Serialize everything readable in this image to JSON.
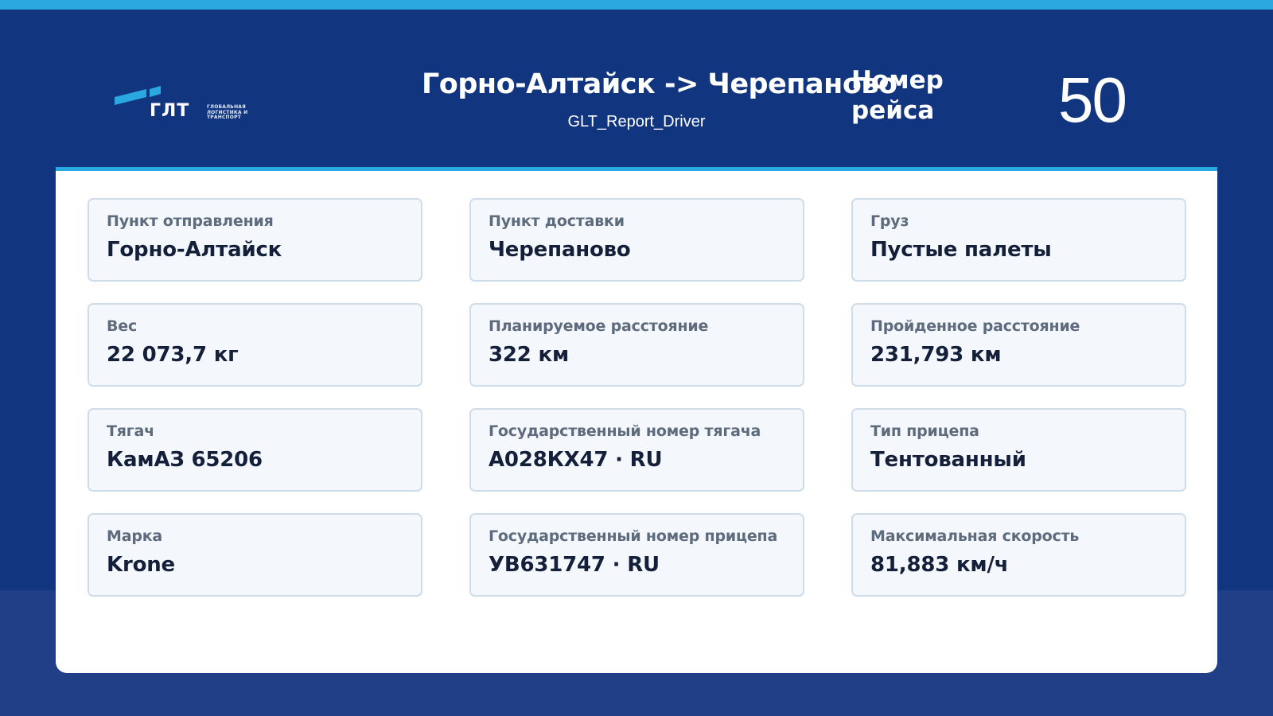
{
  "colors": {
    "background": "#12357f",
    "accent": "#2aa9e0",
    "card": "#ffffff",
    "field_background": "#f4f8fd",
    "field_border": "#cfdcea",
    "label_text": "#5e6b7d",
    "value_text": "#14203a"
  },
  "header": {
    "logo": {
      "name": "ГЛТ",
      "tagline": "ГЛОБАЛЬНАЯ\nЛОГИСТИКА И\nТРАНСПОРТ"
    },
    "route_title": "Горно-Алтайск -> Черепаново",
    "subtitle": "GLT_Report_Driver",
    "trip_label": "Номер рейса",
    "trip_number": "50"
  },
  "fields": [
    {
      "label": "Пункт отправления",
      "value": "Горно-Алтайск"
    },
    {
      "label": "Пункт доставки",
      "value": "Черепаново"
    },
    {
      "label": "Груз",
      "value": "Пустые палеты"
    },
    {
      "label": "Вес",
      "value": "22 073,7 кг"
    },
    {
      "label": "Планируемое расстояние",
      "value": "322 км"
    },
    {
      "label": "Пройденное расстояние",
      "value": "231,793 км"
    },
    {
      "label": "Тягач",
      "value": "КамАЗ 65206"
    },
    {
      "label": "Государственный номер тягача",
      "value": "А028КХ47 · RU"
    },
    {
      "label": "Тип прицепа",
      "value": "Тентованный"
    },
    {
      "label": "Марка",
      "value": "Krone"
    },
    {
      "label": "Государственный номер прицепа",
      "value": "УВ631747 · RU"
    },
    {
      "label": "Максимальная скорость",
      "value": "81,883 км/ч"
    }
  ]
}
